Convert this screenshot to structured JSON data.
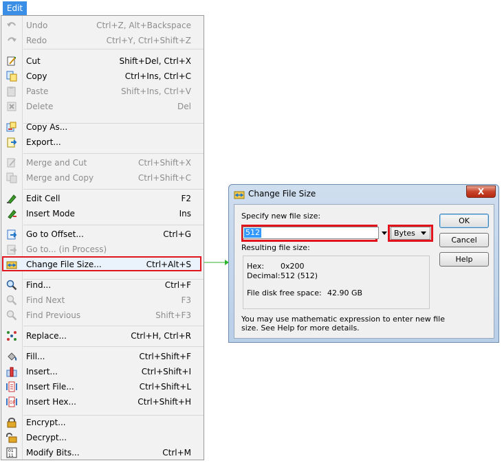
{
  "menu": {
    "title": "Edit",
    "items": [
      {
        "label": "Undo",
        "shortcut": "Ctrl+Z, Alt+Backspace",
        "disabled": true,
        "icon": "undo-icon"
      },
      {
        "label": "Redo",
        "shortcut": "Ctrl+Y, Ctrl+Shift+Z",
        "disabled": true,
        "icon": "redo-icon"
      },
      {
        "label": "Cut",
        "shortcut": "Shift+Del, Ctrl+X",
        "disabled": false,
        "icon": "cut-icon"
      },
      {
        "label": "Copy",
        "shortcut": "Ctrl+Ins, Ctrl+C",
        "disabled": false,
        "icon": "copy-icon"
      },
      {
        "label": "Paste",
        "shortcut": "Shift+Ins, Ctrl+V",
        "disabled": true,
        "icon": "paste-icon"
      },
      {
        "label": "Delete",
        "shortcut": "Del",
        "disabled": true,
        "icon": "delete-icon"
      },
      {
        "label": "Copy As...",
        "shortcut": "",
        "disabled": false,
        "icon": "copy-as-icon"
      },
      {
        "label": "Export...",
        "shortcut": "",
        "disabled": false,
        "icon": "export-icon"
      },
      {
        "label": "Merge and Cut",
        "shortcut": "Ctrl+Shift+X",
        "disabled": true,
        "icon": "merge-cut-icon"
      },
      {
        "label": "Merge and Copy",
        "shortcut": "Ctrl+Shift+C",
        "disabled": true,
        "icon": "merge-copy-icon"
      },
      {
        "label": "Edit Cell",
        "shortcut": "F2",
        "disabled": false,
        "icon": "edit-cell-icon"
      },
      {
        "label": "Insert Mode",
        "shortcut": "Ins",
        "disabled": false,
        "icon": "insert-mode-icon"
      },
      {
        "label": "Go to Offset...",
        "shortcut": "Ctrl+G",
        "disabled": false,
        "icon": "goto-offset-icon"
      },
      {
        "label": "Go to... (in Process)",
        "shortcut": "",
        "disabled": true,
        "icon": "goto-process-icon"
      },
      {
        "label": "Change File Size...",
        "shortcut": "Ctrl+Alt+S",
        "disabled": false,
        "icon": "change-file-size-icon"
      },
      {
        "label": "Find...",
        "shortcut": "Ctrl+F",
        "disabled": false,
        "icon": "find-icon"
      },
      {
        "label": "Find Next",
        "shortcut": "F3",
        "disabled": true,
        "icon": "find-next-icon"
      },
      {
        "label": "Find Previous",
        "shortcut": "Shift+F3",
        "disabled": true,
        "icon": "find-previous-icon"
      },
      {
        "label": "Replace...",
        "shortcut": "Ctrl+H, Ctrl+R",
        "disabled": false,
        "icon": "replace-icon"
      },
      {
        "label": "Fill...",
        "shortcut": "Ctrl+Shift+F",
        "disabled": false,
        "icon": "fill-icon"
      },
      {
        "label": "Insert...",
        "shortcut": "Ctrl+Shift+I",
        "disabled": false,
        "icon": "insert-icon"
      },
      {
        "label": "Insert File...",
        "shortcut": "Ctrl+Shift+L",
        "disabled": false,
        "icon": "insert-file-icon"
      },
      {
        "label": "Insert Hex...",
        "shortcut": "Ctrl+Shift+H",
        "disabled": false,
        "icon": "insert-hex-icon"
      },
      {
        "label": "Encrypt...",
        "shortcut": "",
        "disabled": false,
        "icon": "encrypt-icon"
      },
      {
        "label": "Decrypt...",
        "shortcut": "",
        "disabled": false,
        "icon": "decrypt-icon"
      },
      {
        "label": "Modify Bits...",
        "shortcut": "Ctrl+M",
        "disabled": false,
        "icon": "modify-bits-icon"
      }
    ]
  },
  "dialog": {
    "title": "Change File Size",
    "close_label": "X",
    "specify_label": "Specify new file size:",
    "size_value": "512",
    "unit_value": "Bytes",
    "resulting_label": "Resulting file size:",
    "hex_label": "Hex:",
    "hex_value": "0x200",
    "decimal_label": "Decimal:",
    "decimal_value": "512 (512)",
    "free_space_label": "File disk free space:",
    "free_space_value": "42.90 GB",
    "hint_line1": "You may use mathematic expression to enter new file",
    "hint_line2": "size. See Help for more details.",
    "ok_label": "OK",
    "cancel_label": "Cancel",
    "help_label": "Help"
  },
  "colors": {
    "highlight_border": "#e1141d",
    "menu_title_bg": "#3a8ee6",
    "connector_arrow": "#2db52d"
  }
}
